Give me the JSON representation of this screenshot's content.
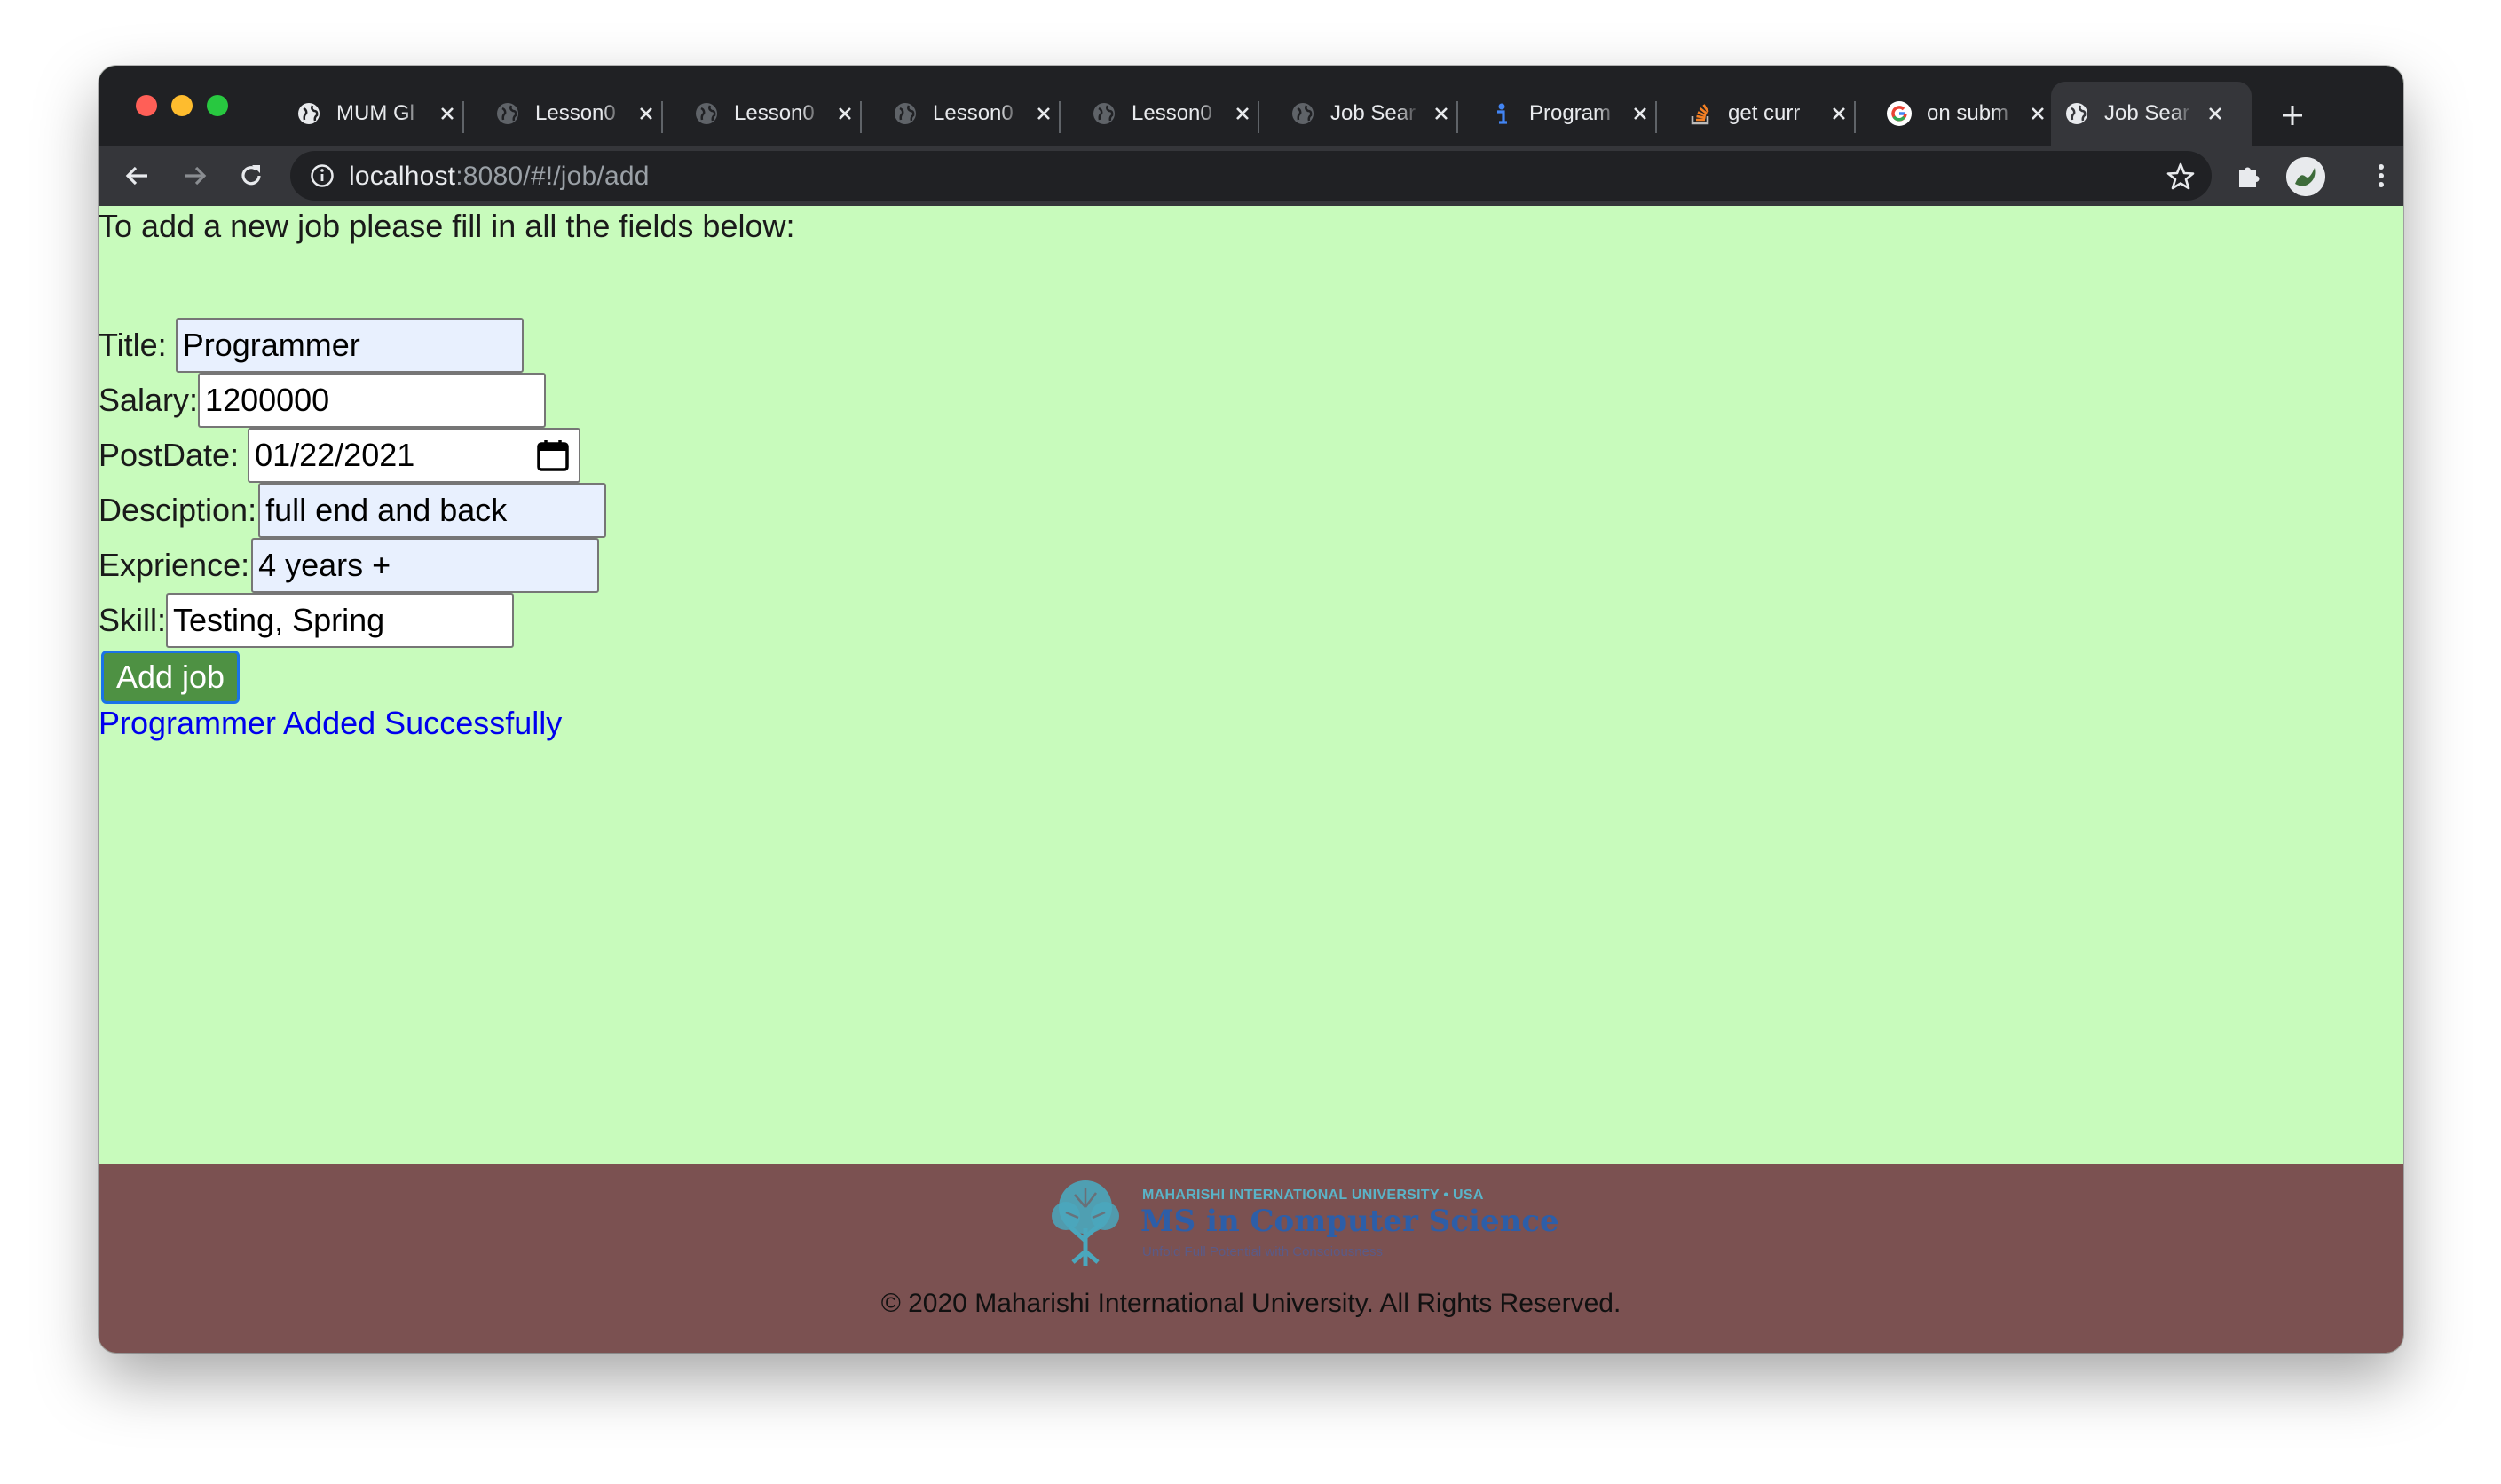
{
  "browser": {
    "tabs": [
      {
        "title": "MUM Gl",
        "favicon": "globe-icon"
      },
      {
        "title": "Lesson0",
        "favicon": "globe-icon"
      },
      {
        "title": "Lesson0",
        "favicon": "globe-icon"
      },
      {
        "title": "Lesson0",
        "favicon": "globe-icon"
      },
      {
        "title": "Lesson0",
        "favicon": "globe-icon"
      },
      {
        "title": "Job Sear",
        "favicon": "globe-icon"
      },
      {
        "title": "Program",
        "favicon": "info-i-icon"
      },
      {
        "title": "get curr",
        "favicon": "stackoverflow-icon"
      },
      {
        "title": "on subm",
        "favicon": "google-icon"
      },
      {
        "title": "Job Sear",
        "favicon": "globe-icon",
        "active": true
      }
    ],
    "url_host": "localhost",
    "url_path": ":8080/#!/job/add"
  },
  "form": {
    "intro": "To add a new job please fill in all the fields below:",
    "title_label": "Title:",
    "title_value": "Programmer",
    "salary_label": "Salary:",
    "salary_value": "1200000",
    "postdate_label": "PostDate:",
    "postdate_value": "01/22/2021",
    "description_label": "Desciption:",
    "description_value": "full end and back",
    "experience_label": "Exprience:",
    "experience_value": "4 years +",
    "skill_label": "Skill:",
    "skill_value": "Testing, Spring",
    "submit_label": "Add job",
    "success_message": "Programmer Added Successfully"
  },
  "footer": {
    "logo_line1": "MAHARISHI INTERNATIONAL UNIVERSITY • USA",
    "logo_line2": "MS in Computer Science",
    "logo_line3": "Unfold Full Potential with Consciousness",
    "copyright": "© 2020 Maharishi International University. All Rights Reserved."
  },
  "colors": {
    "page_bg": "#c8fbbc",
    "footer_bg": "#7b5151",
    "button_bg": "#4e9143",
    "success_text": "#0000ee",
    "autofill_bg": "#e8f0fe"
  }
}
